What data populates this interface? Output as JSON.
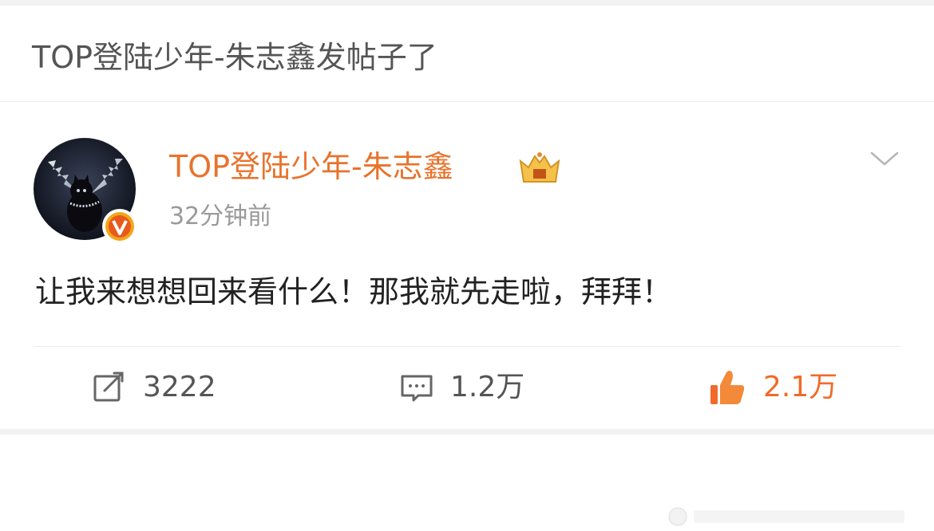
{
  "header": {
    "title": "TOP登陆少年-朱志鑫发帖子了"
  },
  "post": {
    "author_name": "TOP登陆少年-朱志鑫",
    "timestamp": "32分钟前",
    "text": "让我来想想回来看什么！那我就先走啦，拜拜！",
    "badge_icon": "crown-member-icon",
    "verified_icon": "verified-v-icon"
  },
  "actions": {
    "repost_count": "3222",
    "comment_count": "1.2万",
    "like_count": "2.1万"
  },
  "colors": {
    "author": "#e8732c",
    "like_active": "#f06a2a",
    "verified_badge": "#f2a61c"
  }
}
